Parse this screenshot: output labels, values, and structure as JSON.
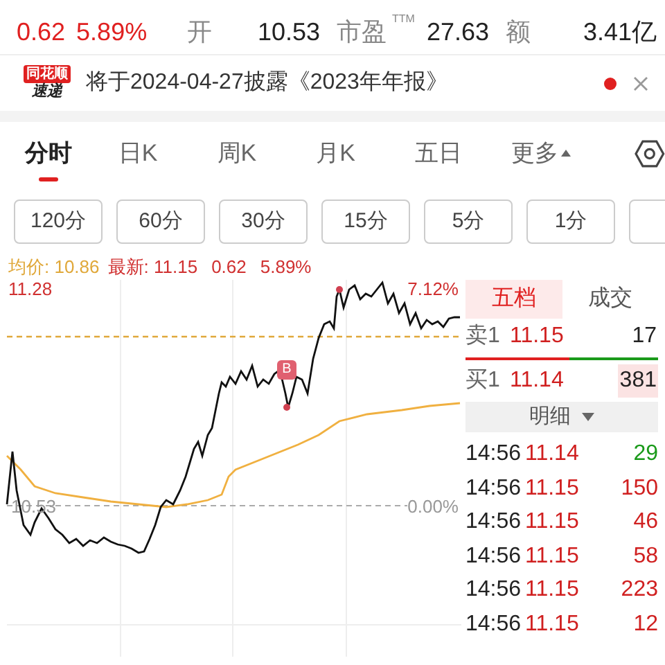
{
  "quote_summary": {
    "change": "0.62",
    "change_percent": "5.89%",
    "items": [
      {
        "label": "开",
        "value": "10.53"
      },
      {
        "label": "市盈",
        "label_sup": "TTM",
        "value": "27.63"
      },
      {
        "label": "额",
        "value": "3.41亿"
      }
    ]
  },
  "notice": {
    "logo_top": "同花顺",
    "logo_bottom": "速递",
    "text": "将于2024-04-27披露《2023年年报》",
    "unread": true
  },
  "chart_tabs": [
    {
      "label": "分时",
      "selected": true
    },
    {
      "label": "日K",
      "selected": false
    },
    {
      "label": "周K",
      "selected": false
    },
    {
      "label": "月K",
      "selected": false
    },
    {
      "label": "五日",
      "selected": false
    },
    {
      "label": "更多",
      "selected": false,
      "kind": "menu"
    }
  ],
  "period_buttons": [
    "120分",
    "60分",
    "30分",
    "15分",
    "5分",
    "1分"
  ],
  "legend": {
    "average": "均价: 10.86",
    "latest": "最新: 11.15",
    "change": "0.62",
    "change_percent": "5.89%"
  },
  "chart": {
    "high_price": "11.28",
    "high_percent": "7.12%",
    "base_price": "10.53",
    "base_percent": "0.00%",
    "marker": "B"
  },
  "order_book": {
    "tabs": [
      {
        "label": "五档",
        "selected": true
      },
      {
        "label": "成交",
        "selected": false
      }
    ],
    "ask": {
      "label": "卖1",
      "price": "11.15",
      "volume": "17",
      "highlighted": false
    },
    "level": 0.54,
    "bid": {
      "label": "买1",
      "price": "11.14",
      "volume": "381",
      "highlighted": true
    },
    "detail_header": "明细",
    "trades": [
      {
        "time": "14:56",
        "price": "11.14",
        "volume": "29",
        "kind": "sell"
      },
      {
        "time": "14:56",
        "price": "11.15",
        "volume": "150",
        "kind": "buy"
      },
      {
        "time": "14:56",
        "price": "11.15",
        "volume": "46",
        "kind": "buy"
      },
      {
        "time": "14:56",
        "price": "11.15",
        "volume": "58",
        "kind": "buy"
      },
      {
        "time": "14:56",
        "price": "11.15",
        "volume": "223",
        "kind": "buy"
      },
      {
        "time": "14:56",
        "price": "11.15",
        "volume": "12",
        "kind": "buy"
      }
    ]
  }
}
